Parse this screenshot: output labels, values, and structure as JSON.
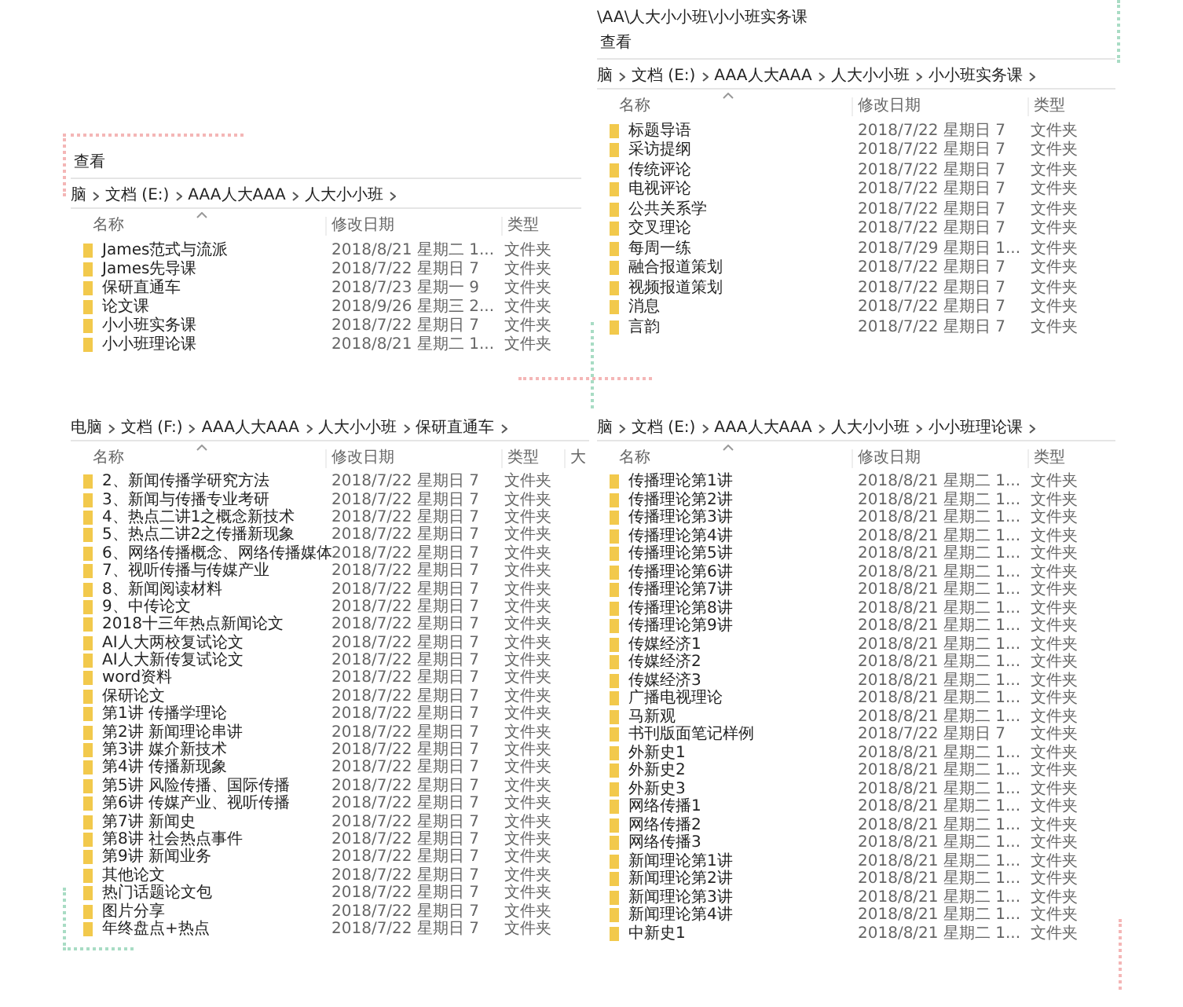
{
  "windows": [
    {
      "title": "\\AA\\人大小小班\\小小班实务课",
      "menu": [
        "查看"
      ],
      "breadcrumb": [
        "脑",
        "文档 (E:)",
        "AAA人大AAA",
        "人大小小班",
        "小小班实务课"
      ],
      "columns": [
        "名称",
        "修改日期",
        "类型"
      ],
      "rows": [
        {
          "name": "标题导语",
          "date": "2018/7/22 星期日 7",
          "type": "文件夹"
        },
        {
          "name": "采访提纲",
          "date": "2018/7/22 星期日 7",
          "type": "文件夹"
        },
        {
          "name": "传统评论",
          "date": "2018/7/22 星期日 7",
          "type": "文件夹"
        },
        {
          "name": "电视评论",
          "date": "2018/7/22 星期日 7",
          "type": "文件夹"
        },
        {
          "name": "公共关系学",
          "date": "2018/7/22 星期日 7",
          "type": "文件夹"
        },
        {
          "name": "交叉理论",
          "date": "2018/7/22 星期日 7",
          "type": "文件夹"
        },
        {
          "name": "每周一练",
          "date": "2018/7/29 星期日 1...",
          "type": "文件夹"
        },
        {
          "name": "融合报道策划",
          "date": "2018/7/22 星期日 7",
          "type": "文件夹"
        },
        {
          "name": "视频报道策划",
          "date": "2018/7/22 星期日 7",
          "type": "文件夹"
        },
        {
          "name": "消息",
          "date": "2018/7/22 星期日 7",
          "type": "文件夹"
        },
        {
          "name": "言韵",
          "date": "2018/7/22 星期日 7",
          "type": "文件夹"
        }
      ]
    },
    {
      "menu": [
        "查看"
      ],
      "breadcrumb": [
        "脑",
        "文档 (E:)",
        "AAA人大AAA",
        "人大小小班"
      ],
      "columns": [
        "名称",
        "修改日期",
        "类型"
      ],
      "rows": [
        {
          "name": "James范式与流派",
          "date": "2018/8/21 星期二 1...",
          "type": "文件夹"
        },
        {
          "name": "James先导课",
          "date": "2018/7/22 星期日 7",
          "type": "文件夹"
        },
        {
          "name": "保研直通车",
          "date": "2018/7/23 星期一 9",
          "type": "文件夹"
        },
        {
          "name": "论文课",
          "date": "2018/9/26 星期三 2...",
          "type": "文件夹"
        },
        {
          "name": "小小班实务课",
          "date": "2018/7/22 星期日 7",
          "type": "文件夹"
        },
        {
          "name": "小小班理论课",
          "date": "2018/8/21 星期二 1...",
          "type": "文件夹"
        }
      ]
    },
    {
      "breadcrumb": [
        "电脑",
        "文档 (F:)",
        "AAA人大AAA",
        "人大小小班",
        "保研直通车"
      ],
      "columns": [
        "名称",
        "修改日期",
        "类型",
        "大"
      ],
      "rows": [
        {
          "name": "2、新闻传播学研究方法",
          "date": "2018/7/22 星期日 7",
          "type": "文件夹"
        },
        {
          "name": "3、新闻与传播专业考研",
          "date": "2018/7/22 星期日 7",
          "type": "文件夹"
        },
        {
          "name": "4、热点二讲1之概念新技术",
          "date": "2018/7/22 星期日 7",
          "type": "文件夹"
        },
        {
          "name": "5、热点二讲2之传播新现象",
          "date": "2018/7/22 星期日 7",
          "type": "文件夹"
        },
        {
          "name": "6、网络传播概念、网络传播媒体",
          "date": "2018/7/22 星期日 7",
          "type": "文件夹"
        },
        {
          "name": "7、视听传播与传媒产业",
          "date": "2018/7/22 星期日 7",
          "type": "文件夹"
        },
        {
          "name": "8、新闻阅读材料",
          "date": "2018/7/22 星期日 7",
          "type": "文件夹"
        },
        {
          "name": "9、中传论文",
          "date": "2018/7/22 星期日 7",
          "type": "文件夹"
        },
        {
          "name": "2018十三年热点新闻论文",
          "date": "2018/7/22 星期日 7",
          "type": "文件夹"
        },
        {
          "name": "AI人大两校复试论文",
          "date": "2018/7/22 星期日 7",
          "type": "文件夹"
        },
        {
          "name": "AI人大新传复试论文",
          "date": "2018/7/22 星期日 7",
          "type": "文件夹"
        },
        {
          "name": "word资料",
          "date": "2018/7/22 星期日 7",
          "type": "文件夹"
        },
        {
          "name": "保研论文",
          "date": "2018/7/22 星期日 7",
          "type": "文件夹"
        },
        {
          "name": "第1讲 传播学理论",
          "date": "2018/7/22 星期日 7",
          "type": "文件夹"
        },
        {
          "name": "第2讲 新闻理论串讲",
          "date": "2018/7/22 星期日 7",
          "type": "文件夹"
        },
        {
          "name": "第3讲 媒介新技术",
          "date": "2018/7/22 星期日 7",
          "type": "文件夹"
        },
        {
          "name": "第4讲 传播新现象",
          "date": "2018/7/22 星期日 7",
          "type": "文件夹"
        },
        {
          "name": "第5讲 风险传播、国际传播",
          "date": "2018/7/22 星期日 7",
          "type": "文件夹"
        },
        {
          "name": "第6讲 传媒产业、视听传播",
          "date": "2018/7/22 星期日 7",
          "type": "文件夹"
        },
        {
          "name": "第7讲 新闻史",
          "date": "2018/7/22 星期日 7",
          "type": "文件夹"
        },
        {
          "name": "第8讲 社会热点事件",
          "date": "2018/7/22 星期日 7",
          "type": "文件夹"
        },
        {
          "name": "第9讲 新闻业务",
          "date": "2018/7/22 星期日 7",
          "type": "文件夹"
        },
        {
          "name": "其他论文",
          "date": "2018/7/22 星期日 7",
          "type": "文件夹"
        },
        {
          "name": "热门话题论文包",
          "date": "2018/7/22 星期日 7",
          "type": "文件夹"
        },
        {
          "name": "图片分享",
          "date": "2018/7/22 星期日 7",
          "type": "文件夹"
        },
        {
          "name": "年终盘点+热点",
          "date": "2018/7/22 星期日 7",
          "type": "文件夹"
        }
      ]
    },
    {
      "breadcrumb": [
        "脑",
        "文档 (E:)",
        "AAA人大AAA",
        "人大小小班",
        "小小班理论课"
      ],
      "columns": [
        "名称",
        "修改日期",
        "类型"
      ],
      "rows": [
        {
          "name": "传播理论第1讲",
          "date": "2018/8/21 星期二 1...",
          "type": "文件夹"
        },
        {
          "name": "传播理论第2讲",
          "date": "2018/8/21 星期二 1...",
          "type": "文件夹"
        },
        {
          "name": "传播理论第3讲",
          "date": "2018/8/21 星期二 1...",
          "type": "文件夹"
        },
        {
          "name": "传播理论第4讲",
          "date": "2018/8/21 星期二 1...",
          "type": "文件夹"
        },
        {
          "name": "传播理论第5讲",
          "date": "2018/8/21 星期二 1...",
          "type": "文件夹"
        },
        {
          "name": "传播理论第6讲",
          "date": "2018/8/21 星期二 1...",
          "type": "文件夹"
        },
        {
          "name": "传播理论第7讲",
          "date": "2018/8/21 星期二 1...",
          "type": "文件夹"
        },
        {
          "name": "传播理论第8讲",
          "date": "2018/8/21 星期二 1...",
          "type": "文件夹"
        },
        {
          "name": "传播理论第9讲",
          "date": "2018/8/21 星期二 1...",
          "type": "文件夹"
        },
        {
          "name": "传媒经济1",
          "date": "2018/8/21 星期二 1...",
          "type": "文件夹"
        },
        {
          "name": "传媒经济2",
          "date": "2018/8/21 星期二 1...",
          "type": "文件夹"
        },
        {
          "name": "传媒经济3",
          "date": "2018/8/21 星期二 1...",
          "type": "文件夹"
        },
        {
          "name": "广播电视理论",
          "date": "2018/8/21 星期二 1...",
          "type": "文件夹"
        },
        {
          "name": "马新观",
          "date": "2018/8/21 星期二 1...",
          "type": "文件夹"
        },
        {
          "name": "书刊版面笔记样例",
          "date": "2018/7/22 星期日 7",
          "type": "文件夹"
        },
        {
          "name": "外新史1",
          "date": "2018/8/21 星期二 1...",
          "type": "文件夹"
        },
        {
          "name": "外新史2",
          "date": "2018/8/21 星期二 1...",
          "type": "文件夹"
        },
        {
          "name": "外新史3",
          "date": "2018/8/21 星期二 1...",
          "type": "文件夹"
        },
        {
          "name": "网络传播1",
          "date": "2018/8/21 星期二 1...",
          "type": "文件夹"
        },
        {
          "name": "网络传播2",
          "date": "2018/8/21 星期二 1...",
          "type": "文件夹"
        },
        {
          "name": "网络传播3",
          "date": "2018/8/21 星期二 1...",
          "type": "文件夹"
        },
        {
          "name": "新闻理论第1讲",
          "date": "2018/8/21 星期二 1...",
          "type": "文件夹"
        },
        {
          "name": "新闻理论第2讲",
          "date": "2018/8/21 星期二 1...",
          "type": "文件夹"
        },
        {
          "name": "新闻理论第3讲",
          "date": "2018/8/21 星期二 1...",
          "type": "文件夹"
        },
        {
          "name": "新闻理论第4讲",
          "date": "2018/8/21 星期二 1...",
          "type": "文件夹"
        },
        {
          "name": "中新史1",
          "date": "2018/8/21 星期二 1...",
          "type": "文件夹"
        }
      ]
    }
  ]
}
